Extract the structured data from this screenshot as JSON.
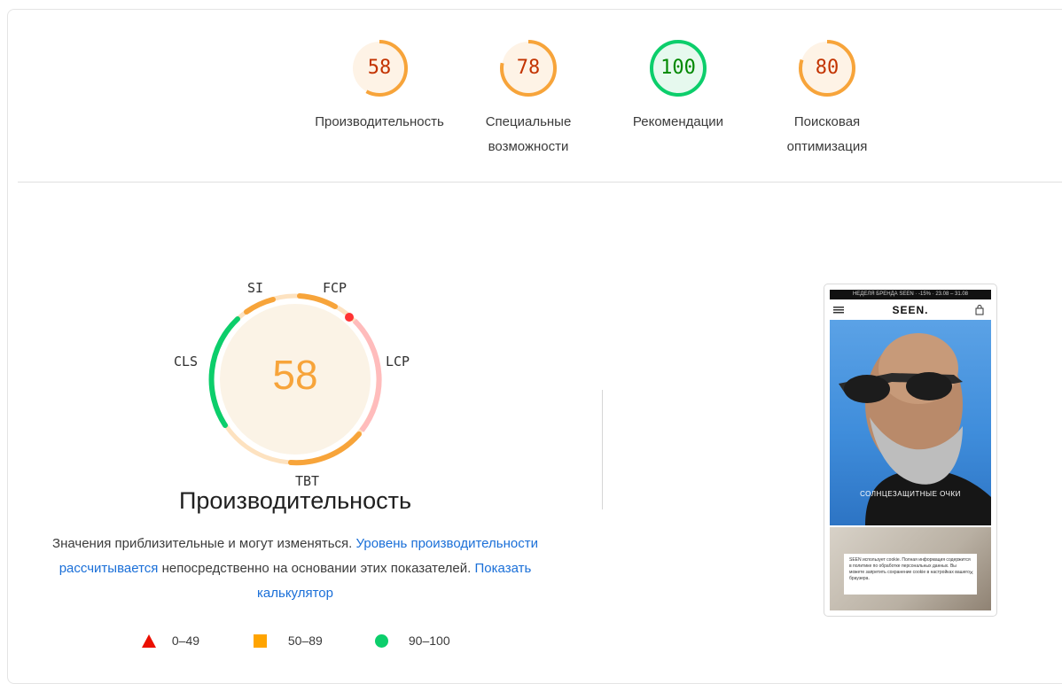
{
  "categories": [
    {
      "name": "performance",
      "score": "58",
      "label": "Производительность",
      "level": "average"
    },
    {
      "name": "accessibility",
      "score": "78",
      "label": "Специальные\nвозможности",
      "level": "average"
    },
    {
      "name": "best-practices",
      "score": "100",
      "label": "Рекомендации",
      "level": "pass"
    },
    {
      "name": "seo",
      "score": "80",
      "label": "Поисковая\nоптимизация",
      "level": "average"
    }
  ],
  "colors": {
    "average": "#f7a43a",
    "average_text": "#c33300",
    "average_bg": "#fef3e6",
    "pass": "#0cce6b",
    "pass_text": "#008800",
    "pass_bg": "#e6f9ee",
    "fail": "#ff4e42"
  },
  "metrics": {
    "si": "SI",
    "fcp": "FCP",
    "lcp": "LCP",
    "tbt": "TBT",
    "cls": "CLS"
  },
  "performance": {
    "score": "58",
    "title": "Производительность",
    "desc_1": "Значения приблизительные и могут изменяться. ",
    "link_1": "Уровень производительности рассчитывается",
    "desc_2": " непосредственно на основании этих показателей. ",
    "link_2": "Показать калькулятор"
  },
  "legend": [
    {
      "shape": "triangle",
      "range": "0–49"
    },
    {
      "shape": "square",
      "range": "50–89"
    },
    {
      "shape": "circle",
      "range": "90–100"
    }
  ],
  "screenshot": {
    "brand": "SEEN.",
    "topbar": "НЕДЕЛЯ БРЕНДА SEEN · -15% · 23.08 – 31.08",
    "hero_caption": "СОЛНЦЕЗАЩИТНЫЕ ОЧКИ",
    "cookie": "SEEN использует cookie. Полная информация содержится в политике по обработке персональных данных. Вы можете запретить сохранение cookie в настройках вашего браузера."
  }
}
